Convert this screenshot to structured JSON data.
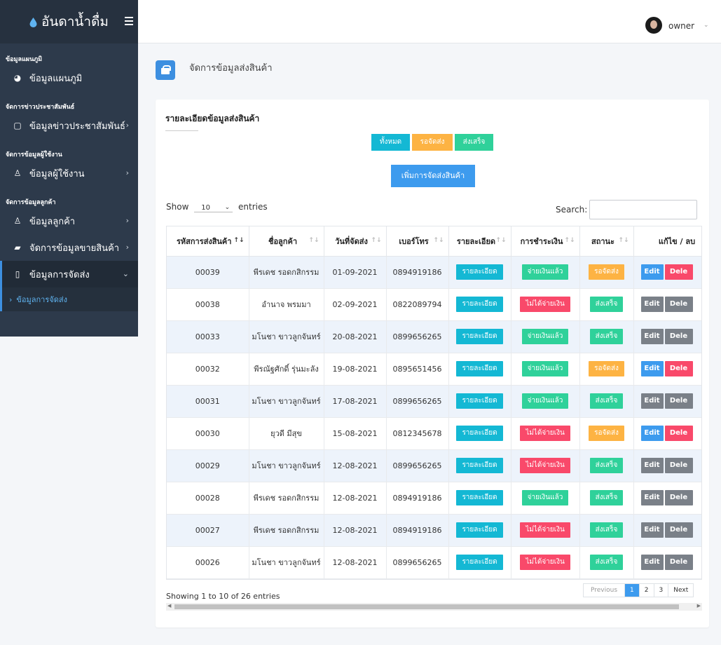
{
  "brand": {
    "name": "อันดาน้ำดื่ม"
  },
  "user": {
    "name": "owner"
  },
  "sidebar": {
    "sections": [
      {
        "title": "ข้อมูลแผนภูมิ",
        "items": [
          {
            "label": "ข้อมูลแผนภูมิ",
            "icon": "pie-chart-icon"
          }
        ]
      },
      {
        "title": "จัดการข่าวประชาสัมพันธ์",
        "items": [
          {
            "label": "ข้อมูลข่าวประชาสัมพันธ์",
            "icon": "clipboard-icon"
          }
        ]
      },
      {
        "title": "จัดการข้อมูลผู้ใช้งาน",
        "items": [
          {
            "label": "ข้อมูลผู้ใช้งาน",
            "icon": "user-icon"
          }
        ]
      },
      {
        "title": "จัดการข้อมูลลูกค้า",
        "items": [
          {
            "label": "ข้อมูลลูกค้า",
            "icon": "users-icon"
          },
          {
            "label": "จัดการข้อมูลขายสินค้า",
            "icon": "shopping-bag-icon"
          },
          {
            "label": "ข้อมูลการจัดส่ง",
            "icon": "box-icon"
          }
        ]
      }
    ],
    "subitem": "ข้อมูลการจัดส่ง"
  },
  "page": {
    "title": "จัดการข้อมูลส่งสินค้า"
  },
  "card": {
    "title": "รายละเอียดข้อมูลส่งสินค้า"
  },
  "filters": {
    "all": "ทั้งหมด",
    "waiting": "รอจัดส่ง",
    "done": "ส่งเสร็จ"
  },
  "add_button": "เพิ่มการจัดส่งสินค้า",
  "length": {
    "show": "Show",
    "value": "10",
    "entries": "entries"
  },
  "search": {
    "label": "Search:",
    "value": ""
  },
  "table": {
    "headers": [
      "รหัสการส่งสินค้า",
      "ชื่อลูกค้า",
      "วันที่จัดส่ง",
      "เบอร์โทร",
      "รายละเอียด",
      "การชำระเงิน",
      "สถานะ",
      "แก้ไข / ลบ"
    ],
    "detail_label": "รายละเอียด",
    "edit_label": "Edit",
    "delete_label": "Dele",
    "rows": [
      {
        "id": "00039",
        "name": "พีรเดช รอดกสิกรรม",
        "date": "01-09-2021",
        "phone": "0894919186",
        "payment": "จ่ายเงินแล้ว",
        "paid": true,
        "status": "รอจัดส่ง",
        "waiting": true
      },
      {
        "id": "00038",
        "name": "อำนาจ พรมมา",
        "date": "02-09-2021",
        "phone": "0822089794",
        "payment": "ไม่ได้จ่ายเงิน",
        "paid": false,
        "status": "ส่งเสร็จ",
        "waiting": false
      },
      {
        "id": "00033",
        "name": "มโนชา ขาวลูกจันทร์",
        "date": "20-08-2021",
        "phone": "0899656265",
        "payment": "จ่ายเงินแล้ว",
        "paid": true,
        "status": "ส่งเสร็จ",
        "waiting": false
      },
      {
        "id": "00032",
        "name": "พีรณัฐศักดิ์ รุ่นมะลัง",
        "date": "19-08-2021",
        "phone": "0895651456",
        "payment": "จ่ายเงินแล้ว",
        "paid": true,
        "status": "รอจัดส่ง",
        "waiting": true
      },
      {
        "id": "00031",
        "name": "มโนชา ขาวลูกจันทร์",
        "date": "17-08-2021",
        "phone": "0899656265",
        "payment": "จ่ายเงินแล้ว",
        "paid": true,
        "status": "ส่งเสร็จ",
        "waiting": false
      },
      {
        "id": "00030",
        "name": "ยุวดี มีสุข",
        "date": "15-08-2021",
        "phone": "0812345678",
        "payment": "ไม่ได้จ่ายเงิน",
        "paid": false,
        "status": "รอจัดส่ง",
        "waiting": true
      },
      {
        "id": "00029",
        "name": "มโนชา ขาวลูกจันทร์",
        "date": "12-08-2021",
        "phone": "0899656265",
        "payment": "ไม่ได้จ่ายเงิน",
        "paid": false,
        "status": "ส่งเสร็จ",
        "waiting": false
      },
      {
        "id": "00028",
        "name": "พีรเดช รอดกสิกรรม",
        "date": "12-08-2021",
        "phone": "0894919186",
        "payment": "จ่ายเงินแล้ว",
        "paid": true,
        "status": "ส่งเสร็จ",
        "waiting": false
      },
      {
        "id": "00027",
        "name": "พีรเดช รอดกสิกรรม",
        "date": "12-08-2021",
        "phone": "0894919186",
        "payment": "ไม่ได้จ่ายเงิน",
        "paid": false,
        "status": "ส่งเสร็จ",
        "waiting": false
      },
      {
        "id": "00026",
        "name": "มโนชา ขาวลูกจันทร์",
        "date": "12-08-2021",
        "phone": "0899656265",
        "payment": "ไม่ได้จ่ายเงิน",
        "paid": false,
        "status": "ส่งเสร็จ",
        "waiting": false
      }
    ]
  },
  "info": "Showing 1 to 10 of 26 entries",
  "pagination": {
    "previous": "Previous",
    "pages": [
      "1",
      "2",
      "3"
    ],
    "current": "1",
    "next": "Next"
  },
  "colors": {
    "sidebar": "#2d3a4b",
    "accent": "#3d9bee",
    "info": "#14b8d4",
    "success": "#2fd19a",
    "danger": "#f9496a",
    "warning": "#fdb343"
  }
}
